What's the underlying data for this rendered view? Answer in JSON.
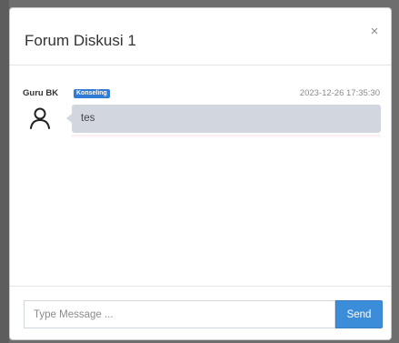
{
  "modal": {
    "title": "Forum Diskusi 1",
    "close_label": "×"
  },
  "message": {
    "sender": "Guru BK",
    "badge": "Konseling",
    "timestamp": "2023-12-26 17:35:30",
    "text": "tes",
    "avatar_icon": "user-outline-icon",
    "bubble_color": "#d2d6de"
  },
  "composer": {
    "placeholder": "Type Message ...",
    "value": "",
    "send_label": "Send",
    "accent": "#3c8dd9"
  },
  "colors": {
    "badge": "#2f7bd6"
  }
}
